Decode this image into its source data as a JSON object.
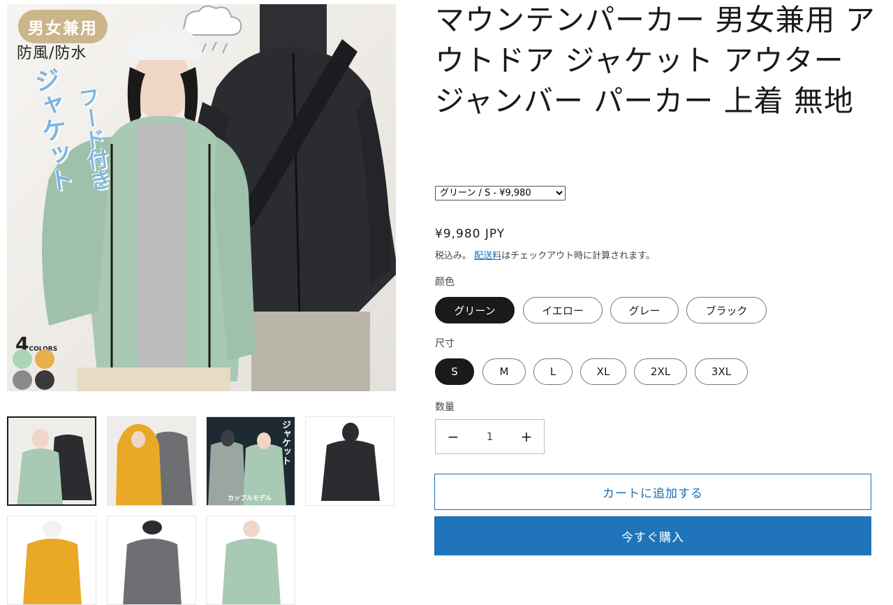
{
  "product": {
    "title": "マウンテンパーカー 男女兼用 アウトドア ジャケット アウター ジャンバー パーカー 上着 無地",
    "variant_selected": "グリーン / S - ¥9,980",
    "price": "¥9,980 JPY",
    "tax_included": "税込み。",
    "shipping_link": "配送料",
    "shipping_suffix": "はチェックアウト時に計算されます。"
  },
  "main_image": {
    "badge": "男女兼用",
    "subtitle": "防風/防水",
    "vertical_text_1": "ジャケット",
    "vertical_text_2": "フード付き",
    "colors_count": "4",
    "colors_word": "COLORS"
  },
  "thumbnails": {
    "third_caption_top": "ジャケット",
    "third_caption_bottom": "カップルモデル"
  },
  "colors": {
    "label": "颜色",
    "options": [
      "グリーン",
      "イエロー",
      "グレー",
      "ブラック"
    ],
    "selected": "グリーン",
    "swatches": [
      "#a8d5b5",
      "#e6b04a",
      "#8a8a8a",
      "#3a3a3a"
    ]
  },
  "sizes": {
    "label": "尺寸",
    "options": [
      "S",
      "M",
      "L",
      "XL",
      "2XL",
      "3XL"
    ],
    "selected": "S"
  },
  "quantity": {
    "label": "数量",
    "value": "1",
    "minus": "−",
    "plus": "+"
  },
  "buttons": {
    "add_to_cart": "カートに追加する",
    "buy_now": "今すぐ購入"
  },
  "theme": {
    "accent": "#1f74ba",
    "jacket_green": "#a8c9b4",
    "jacket_black": "#2b2d30",
    "jacket_yellow": "#e9a826"
  }
}
